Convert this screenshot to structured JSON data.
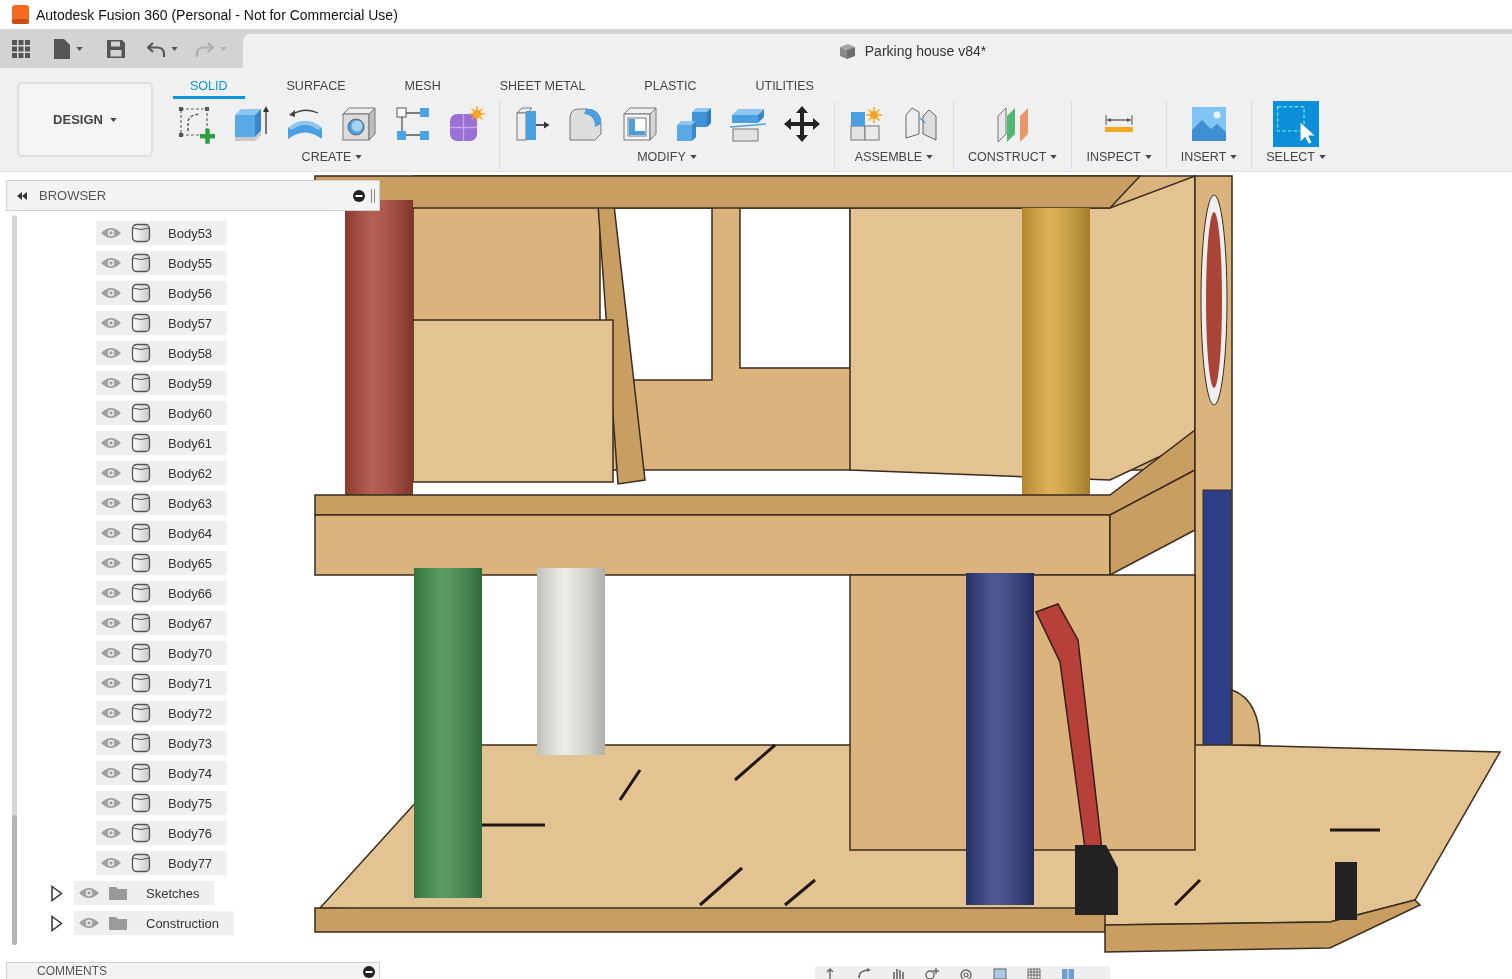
{
  "window": {
    "title": "Autodesk Fusion 360 (Personal - Not for Commercial Use)"
  },
  "document_tab": {
    "title": "Parking house v84*"
  },
  "workspace_button": {
    "label": "DESIGN"
  },
  "tabs": [
    {
      "label": "SOLID",
      "selected": true
    },
    {
      "label": "SURFACE",
      "selected": false
    },
    {
      "label": "MESH",
      "selected": false
    },
    {
      "label": "SHEET METAL",
      "selected": false
    },
    {
      "label": "PLASTIC",
      "selected": false
    },
    {
      "label": "UTILITIES",
      "selected": false
    }
  ],
  "tool_groups": [
    {
      "label": "CREATE",
      "tools": [
        {
          "kind": "sketch"
        },
        {
          "kind": "extrude"
        },
        {
          "kind": "revolve"
        },
        {
          "kind": "hole"
        },
        {
          "kind": "pattern"
        },
        {
          "kind": "form"
        }
      ]
    },
    {
      "label": "MODIFY",
      "tools": [
        {
          "kind": "press_pull"
        },
        {
          "kind": "fillet"
        },
        {
          "kind": "shell"
        },
        {
          "kind": "combine"
        },
        {
          "kind": "split"
        },
        {
          "kind": "move"
        }
      ]
    },
    {
      "label": "ASSEMBLE",
      "tools": [
        {
          "kind": "new_component"
        },
        {
          "kind": "joint"
        }
      ]
    },
    {
      "label": "CONSTRUCT",
      "tools": [
        {
          "kind": "plane"
        }
      ]
    },
    {
      "label": "INSPECT",
      "tools": [
        {
          "kind": "measure"
        }
      ]
    },
    {
      "label": "INSERT",
      "tools": [
        {
          "kind": "image"
        }
      ]
    },
    {
      "label": "SELECT",
      "tools": [
        {
          "kind": "select"
        }
      ]
    }
  ],
  "browser": {
    "title": "BROWSER",
    "items": [
      {
        "kind": "body",
        "label": "Body53",
        "visible": true
      },
      {
        "kind": "body",
        "label": "Body55",
        "visible": true
      },
      {
        "kind": "body",
        "label": "Body56",
        "visible": true
      },
      {
        "kind": "body",
        "label": "Body57",
        "visible": true
      },
      {
        "kind": "body",
        "label": "Body58",
        "visible": true
      },
      {
        "kind": "body",
        "label": "Body59",
        "visible": true
      },
      {
        "kind": "body",
        "label": "Body60",
        "visible": true
      },
      {
        "kind": "body",
        "label": "Body61",
        "visible": true
      },
      {
        "kind": "body",
        "label": "Body62",
        "visible": true
      },
      {
        "kind": "body",
        "label": "Body63",
        "visible": true
      },
      {
        "kind": "body",
        "label": "Body64",
        "visible": true
      },
      {
        "kind": "body",
        "label": "Body65",
        "visible": true
      },
      {
        "kind": "body",
        "label": "Body66",
        "visible": true
      },
      {
        "kind": "body",
        "label": "Body67",
        "visible": true
      },
      {
        "kind": "body",
        "label": "Body70",
        "visible": true
      },
      {
        "kind": "body",
        "label": "Body71",
        "visible": true
      },
      {
        "kind": "body",
        "label": "Body72",
        "visible": true
      },
      {
        "kind": "body",
        "label": "Body73",
        "visible": true
      },
      {
        "kind": "body",
        "label": "Body74",
        "visible": true
      },
      {
        "kind": "body",
        "label": "Body75",
        "visible": true
      },
      {
        "kind": "body",
        "label": "Body76",
        "visible": true
      },
      {
        "kind": "body",
        "label": "Body77",
        "visible": true
      },
      {
        "kind": "folder",
        "label": "Sketches",
        "visible": true,
        "expanded": false
      },
      {
        "kind": "folder",
        "label": "Construction",
        "visible": true,
        "expanded": false
      }
    ]
  },
  "comments": {
    "title": "COMMENTS"
  }
}
